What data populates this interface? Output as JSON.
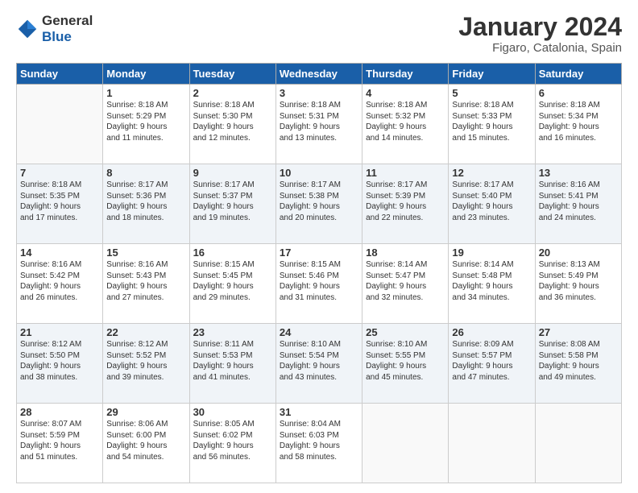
{
  "logo": {
    "line1": "General",
    "line2": "Blue"
  },
  "title": "January 2024",
  "subtitle": "Figaro, Catalonia, Spain",
  "days_header": [
    "Sunday",
    "Monday",
    "Tuesday",
    "Wednesday",
    "Thursday",
    "Friday",
    "Saturday"
  ],
  "weeks": [
    [
      {
        "day": "",
        "info": ""
      },
      {
        "day": "1",
        "info": "Sunrise: 8:18 AM\nSunset: 5:29 PM\nDaylight: 9 hours\nand 11 minutes."
      },
      {
        "day": "2",
        "info": "Sunrise: 8:18 AM\nSunset: 5:30 PM\nDaylight: 9 hours\nand 12 minutes."
      },
      {
        "day": "3",
        "info": "Sunrise: 8:18 AM\nSunset: 5:31 PM\nDaylight: 9 hours\nand 13 minutes."
      },
      {
        "day": "4",
        "info": "Sunrise: 8:18 AM\nSunset: 5:32 PM\nDaylight: 9 hours\nand 14 minutes."
      },
      {
        "day": "5",
        "info": "Sunrise: 8:18 AM\nSunset: 5:33 PM\nDaylight: 9 hours\nand 15 minutes."
      },
      {
        "day": "6",
        "info": "Sunrise: 8:18 AM\nSunset: 5:34 PM\nDaylight: 9 hours\nand 16 minutes."
      }
    ],
    [
      {
        "day": "7",
        "info": "Sunrise: 8:18 AM\nSunset: 5:35 PM\nDaylight: 9 hours\nand 17 minutes."
      },
      {
        "day": "8",
        "info": "Sunrise: 8:17 AM\nSunset: 5:36 PM\nDaylight: 9 hours\nand 18 minutes."
      },
      {
        "day": "9",
        "info": "Sunrise: 8:17 AM\nSunset: 5:37 PM\nDaylight: 9 hours\nand 19 minutes."
      },
      {
        "day": "10",
        "info": "Sunrise: 8:17 AM\nSunset: 5:38 PM\nDaylight: 9 hours\nand 20 minutes."
      },
      {
        "day": "11",
        "info": "Sunrise: 8:17 AM\nSunset: 5:39 PM\nDaylight: 9 hours\nand 22 minutes."
      },
      {
        "day": "12",
        "info": "Sunrise: 8:17 AM\nSunset: 5:40 PM\nDaylight: 9 hours\nand 23 minutes."
      },
      {
        "day": "13",
        "info": "Sunrise: 8:16 AM\nSunset: 5:41 PM\nDaylight: 9 hours\nand 24 minutes."
      }
    ],
    [
      {
        "day": "14",
        "info": "Sunrise: 8:16 AM\nSunset: 5:42 PM\nDaylight: 9 hours\nand 26 minutes."
      },
      {
        "day": "15",
        "info": "Sunrise: 8:16 AM\nSunset: 5:43 PM\nDaylight: 9 hours\nand 27 minutes."
      },
      {
        "day": "16",
        "info": "Sunrise: 8:15 AM\nSunset: 5:45 PM\nDaylight: 9 hours\nand 29 minutes."
      },
      {
        "day": "17",
        "info": "Sunrise: 8:15 AM\nSunset: 5:46 PM\nDaylight: 9 hours\nand 31 minutes."
      },
      {
        "day": "18",
        "info": "Sunrise: 8:14 AM\nSunset: 5:47 PM\nDaylight: 9 hours\nand 32 minutes."
      },
      {
        "day": "19",
        "info": "Sunrise: 8:14 AM\nSunset: 5:48 PM\nDaylight: 9 hours\nand 34 minutes."
      },
      {
        "day": "20",
        "info": "Sunrise: 8:13 AM\nSunset: 5:49 PM\nDaylight: 9 hours\nand 36 minutes."
      }
    ],
    [
      {
        "day": "21",
        "info": "Sunrise: 8:12 AM\nSunset: 5:50 PM\nDaylight: 9 hours\nand 38 minutes."
      },
      {
        "day": "22",
        "info": "Sunrise: 8:12 AM\nSunset: 5:52 PM\nDaylight: 9 hours\nand 39 minutes."
      },
      {
        "day": "23",
        "info": "Sunrise: 8:11 AM\nSunset: 5:53 PM\nDaylight: 9 hours\nand 41 minutes."
      },
      {
        "day": "24",
        "info": "Sunrise: 8:10 AM\nSunset: 5:54 PM\nDaylight: 9 hours\nand 43 minutes."
      },
      {
        "day": "25",
        "info": "Sunrise: 8:10 AM\nSunset: 5:55 PM\nDaylight: 9 hours\nand 45 minutes."
      },
      {
        "day": "26",
        "info": "Sunrise: 8:09 AM\nSunset: 5:57 PM\nDaylight: 9 hours\nand 47 minutes."
      },
      {
        "day": "27",
        "info": "Sunrise: 8:08 AM\nSunset: 5:58 PM\nDaylight: 9 hours\nand 49 minutes."
      }
    ],
    [
      {
        "day": "28",
        "info": "Sunrise: 8:07 AM\nSunset: 5:59 PM\nDaylight: 9 hours\nand 51 minutes."
      },
      {
        "day": "29",
        "info": "Sunrise: 8:06 AM\nSunset: 6:00 PM\nDaylight: 9 hours\nand 54 minutes."
      },
      {
        "day": "30",
        "info": "Sunrise: 8:05 AM\nSunset: 6:02 PM\nDaylight: 9 hours\nand 56 minutes."
      },
      {
        "day": "31",
        "info": "Sunrise: 8:04 AM\nSunset: 6:03 PM\nDaylight: 9 hours\nand 58 minutes."
      },
      {
        "day": "",
        "info": ""
      },
      {
        "day": "",
        "info": ""
      },
      {
        "day": "",
        "info": ""
      }
    ]
  ]
}
